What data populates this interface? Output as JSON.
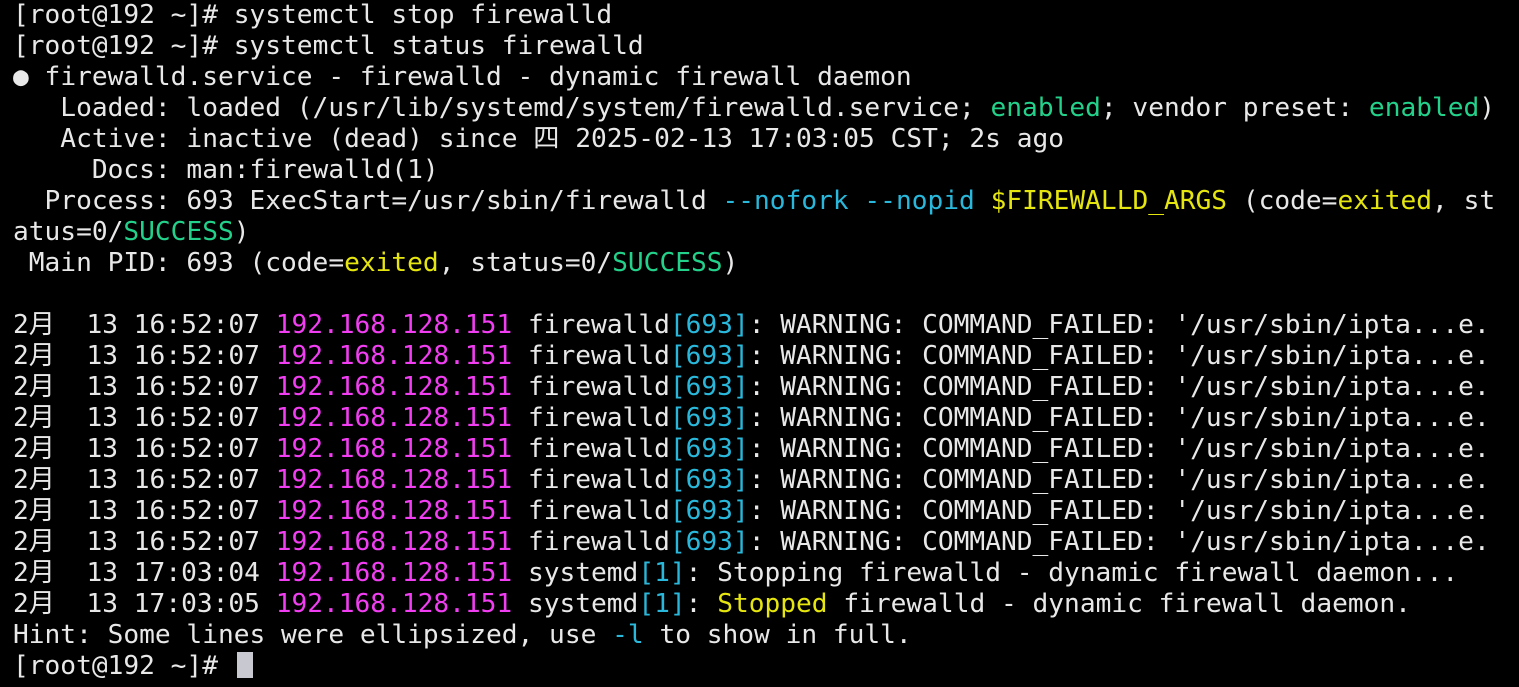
{
  "terminal": {
    "prompt": "[root@192 ~]# ",
    "commands": [
      "systemctl stop firewalld",
      "systemctl status firewalld"
    ],
    "status": {
      "bullet": "●",
      "header": " firewalld.service - firewalld - dynamic firewall daemon",
      "loaded_prefix": "   Loaded: loaded (/usr/lib/systemd/system/firewalld.service; ",
      "loaded_enabled": "enabled",
      "loaded_mid": "; vendor preset: ",
      "loaded_preset": "enabled",
      "loaded_suffix": ")",
      "active": "   Active: inactive (dead) since 四 2025-02-13 17:03:05 CST; 2s ago",
      "docs": "     Docs: man:firewalld(1)",
      "process_prefix": "  Process: 693 ExecStart=/usr/sbin/firewalld ",
      "process_opt1": "--nofork",
      "process_space": " ",
      "process_opt2": "--nopid",
      "process_space2": " ",
      "process_var": "$FIREWALLD_ARGS",
      "process_code_prefix": " (code=",
      "process_code": "exited",
      "process_tail": ", st",
      "process_wrap_prefix": "atus=0/",
      "process_wrap_success": "SUCCESS",
      "process_wrap_suffix": ")",
      "mainpid_prefix": " Main PID: 693 (code=",
      "mainpid_code": "exited",
      "mainpid_mid": ", status=0/",
      "mainpid_success": "SUCCESS",
      "mainpid_suffix": ")"
    },
    "log": [
      {
        "date": "2月  13 16:52:07 ",
        "host": "192.168.128.151",
        "proc": " firewalld",
        "pid": "[693]",
        "msg": ": WARNING: COMMAND_FAILED: '/usr/sbin/ipta...e.",
        "msg_hl": ""
      },
      {
        "date": "2月  13 16:52:07 ",
        "host": "192.168.128.151",
        "proc": " firewalld",
        "pid": "[693]",
        "msg": ": WARNING: COMMAND_FAILED: '/usr/sbin/ipta...e.",
        "msg_hl": ""
      },
      {
        "date": "2月  13 16:52:07 ",
        "host": "192.168.128.151",
        "proc": " firewalld",
        "pid": "[693]",
        "msg": ": WARNING: COMMAND_FAILED: '/usr/sbin/ipta...e.",
        "msg_hl": ""
      },
      {
        "date": "2月  13 16:52:07 ",
        "host": "192.168.128.151",
        "proc": " firewalld",
        "pid": "[693]",
        "msg": ": WARNING: COMMAND_FAILED: '/usr/sbin/ipta...e.",
        "msg_hl": ""
      },
      {
        "date": "2月  13 16:52:07 ",
        "host": "192.168.128.151",
        "proc": " firewalld",
        "pid": "[693]",
        "msg": ": WARNING: COMMAND_FAILED: '/usr/sbin/ipta...e.",
        "msg_hl": ""
      },
      {
        "date": "2月  13 16:52:07 ",
        "host": "192.168.128.151",
        "proc": " firewalld",
        "pid": "[693]",
        "msg": ": WARNING: COMMAND_FAILED: '/usr/sbin/ipta...e.",
        "msg_hl": ""
      },
      {
        "date": "2月  13 16:52:07 ",
        "host": "192.168.128.151",
        "proc": " firewalld",
        "pid": "[693]",
        "msg": ": WARNING: COMMAND_FAILED: '/usr/sbin/ipta...e.",
        "msg_hl": ""
      },
      {
        "date": "2月  13 16:52:07 ",
        "host": "192.168.128.151",
        "proc": " firewalld",
        "pid": "[693]",
        "msg": ": WARNING: COMMAND_FAILED: '/usr/sbin/ipta...e.",
        "msg_hl": ""
      },
      {
        "date": "2月  13 17:03:04 ",
        "host": "192.168.128.151",
        "proc": " systemd",
        "pid": "[1]",
        "msg": ": Stopping firewalld - dynamic firewall daemon...",
        "msg_hl": ""
      },
      {
        "date": "2月  13 17:03:05 ",
        "host": "192.168.128.151",
        "proc": " systemd",
        "pid": "[1]",
        "msg": " firewalld - dynamic firewall daemon.",
        "msg_hl": "Stopped",
        "msg_pre": ": "
      }
    ],
    "hint_prefix": "Hint: Some lines were ellipsized, use ",
    "hint_flag": "-l",
    "hint_suffix": " to show in full.",
    "final_prompt": "[root@192 ~]# ",
    "colors": {
      "background": "#000000",
      "foreground": "#e8e8e8",
      "green": "#23d18b",
      "blue": "#29b8db",
      "yellow": "#e5e510",
      "magenta": "#f23ef2"
    }
  }
}
